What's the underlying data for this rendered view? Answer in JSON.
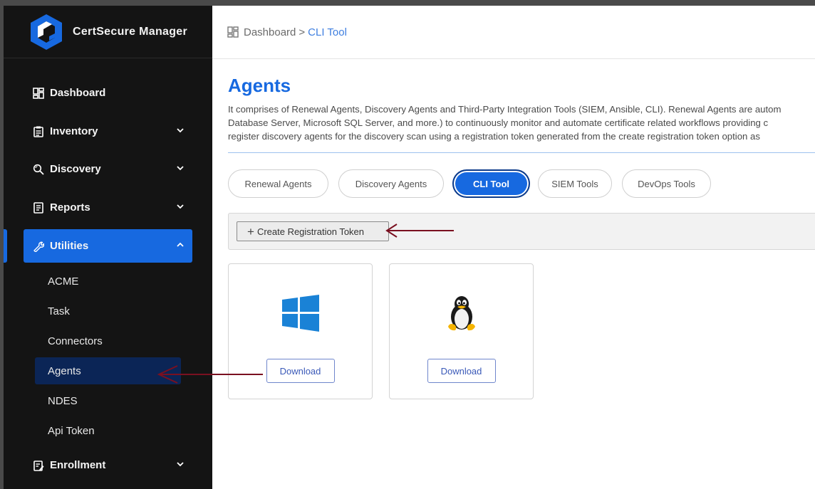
{
  "app": {
    "name": "CertSecure Manager",
    "logo_icon": "certsecure-logo-icon",
    "brand_color": "#1769e0"
  },
  "sidebar": {
    "items": [
      {
        "label": "Dashboard",
        "icon": "dashboard-icon",
        "expandable": false
      },
      {
        "label": "Inventory",
        "icon": "inventory-icon",
        "expandable": true
      },
      {
        "label": "Discovery",
        "icon": "discovery-icon",
        "expandable": true
      },
      {
        "label": "Reports",
        "icon": "reports-icon",
        "expandable": true
      },
      {
        "label": "Utilities",
        "icon": "wrench-icon",
        "expandable": true,
        "expanded": true,
        "active": true
      },
      {
        "label": "Enrollment",
        "icon": "enrollment-icon",
        "expandable": true
      }
    ],
    "utilities_subitems": [
      {
        "label": "ACME"
      },
      {
        "label": "Task"
      },
      {
        "label": "Connectors"
      },
      {
        "label": "Agents",
        "current": true
      },
      {
        "label": "NDES"
      },
      {
        "label": "Api Token"
      }
    ]
  },
  "breadcrumb": {
    "root": "Dashboard",
    "separator": ">",
    "current": "CLI Tool"
  },
  "page": {
    "title": "Agents",
    "description_lines": [
      "It comprises of Renewal Agents, Discovery Agents and Third-Party Integration Tools (SIEM, Ansible, CLI). Renewal Agents are autom",
      "Database Server, Microsoft SQL Server, and more.) to continuously monitor and automate certificate related workflows providing c",
      "register discovery agents for the discovery scan using a registration token generated from the create registration token option as"
    ]
  },
  "tabs": [
    {
      "label": "Renewal Agents",
      "active": false
    },
    {
      "label": "Discovery Agents",
      "active": false
    },
    {
      "label": "CLI Tool",
      "active": true
    },
    {
      "label": "SIEM Tools",
      "active": false
    },
    {
      "label": "DevOps Tools",
      "active": false
    }
  ],
  "toolbar": {
    "create_token_label": "Create Registration Token"
  },
  "downloads": [
    {
      "os_icon": "windows-icon",
      "button_label": "Download"
    },
    {
      "os_icon": "linux-tux-icon",
      "button_label": "Download"
    }
  ],
  "annotations": {
    "arrow_color": "#7a1020"
  }
}
